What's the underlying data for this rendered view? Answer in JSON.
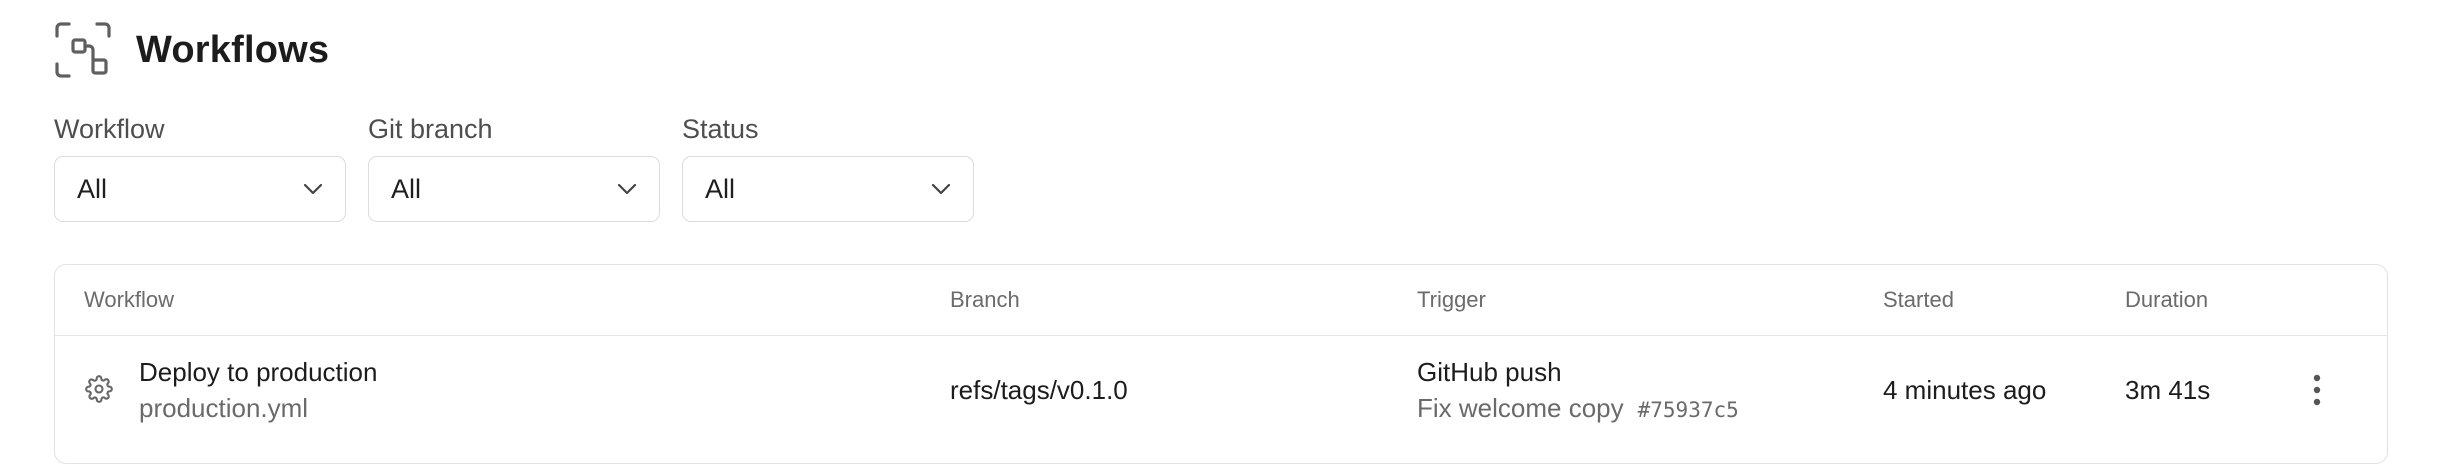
{
  "header": {
    "title": "Workflows",
    "icon": "workflows-icon"
  },
  "filters": [
    {
      "label": "Workflow",
      "value": "All"
    },
    {
      "label": "Git branch",
      "value": "All"
    },
    {
      "label": "Status",
      "value": "All"
    }
  ],
  "table": {
    "columns": [
      "Workflow",
      "Branch",
      "Trigger",
      "Started",
      "Duration"
    ],
    "rows": [
      {
        "icon": "gear-icon",
        "workflow_name": "Deploy to production",
        "workflow_file": "production.yml",
        "branch": "refs/tags/v0.1.0",
        "trigger_title": "GitHub push",
        "trigger_message": "Fix welcome copy",
        "commit_sha": "#75937c5",
        "started": "4 minutes ago",
        "duration": "3m 41s",
        "menu_icon": "more-vertical-icon"
      }
    ]
  },
  "colors": {
    "text_primary": "#1c1c1c",
    "text_secondary": "#6a6a6a",
    "border": "#dcdcdc"
  }
}
